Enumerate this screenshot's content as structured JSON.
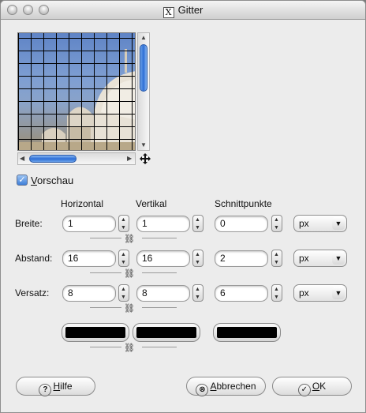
{
  "window": {
    "title": "Gitter",
    "title_icon_glyph": "X"
  },
  "preview": {
    "checkbox_checked": true,
    "checkbox_label_underlined": "V",
    "checkbox_label_rest": "orschau"
  },
  "columns": {
    "horizontal": "Horizontal",
    "vertical": "Vertikal",
    "intersection": "Schnittpunkte"
  },
  "rows": [
    {
      "label": "Breite:",
      "horizontal": "1",
      "vertical": "1",
      "intersection": "0",
      "unit": "px"
    },
    {
      "label": "Abstand:",
      "horizontal": "16",
      "vertical": "16",
      "intersection": "2",
      "unit": "px"
    },
    {
      "label": "Versatz:",
      "horizontal": "8",
      "vertical": "8",
      "intersection": "6",
      "unit": "px"
    }
  ],
  "colors": {
    "horizontal": "#000000",
    "vertical": "#000000",
    "intersection": "#000000"
  },
  "buttons": {
    "help_icon": "?",
    "help_underlined": "H",
    "help_rest": "ilfe",
    "cancel_icon": "⊗",
    "cancel_underlined": "A",
    "cancel_rest": "bbrechen",
    "ok_icon": "✓",
    "ok_underlined": "O",
    "ok_rest": "K"
  },
  "icons": {
    "check": "checkmark-icon",
    "spinner_up": "▲",
    "spinner_down": "▼",
    "dropdown": "▼",
    "chain": "⛓",
    "scroll_up": "▲",
    "scroll_down": "▼",
    "scroll_left": "◀",
    "scroll_right": "▶"
  }
}
